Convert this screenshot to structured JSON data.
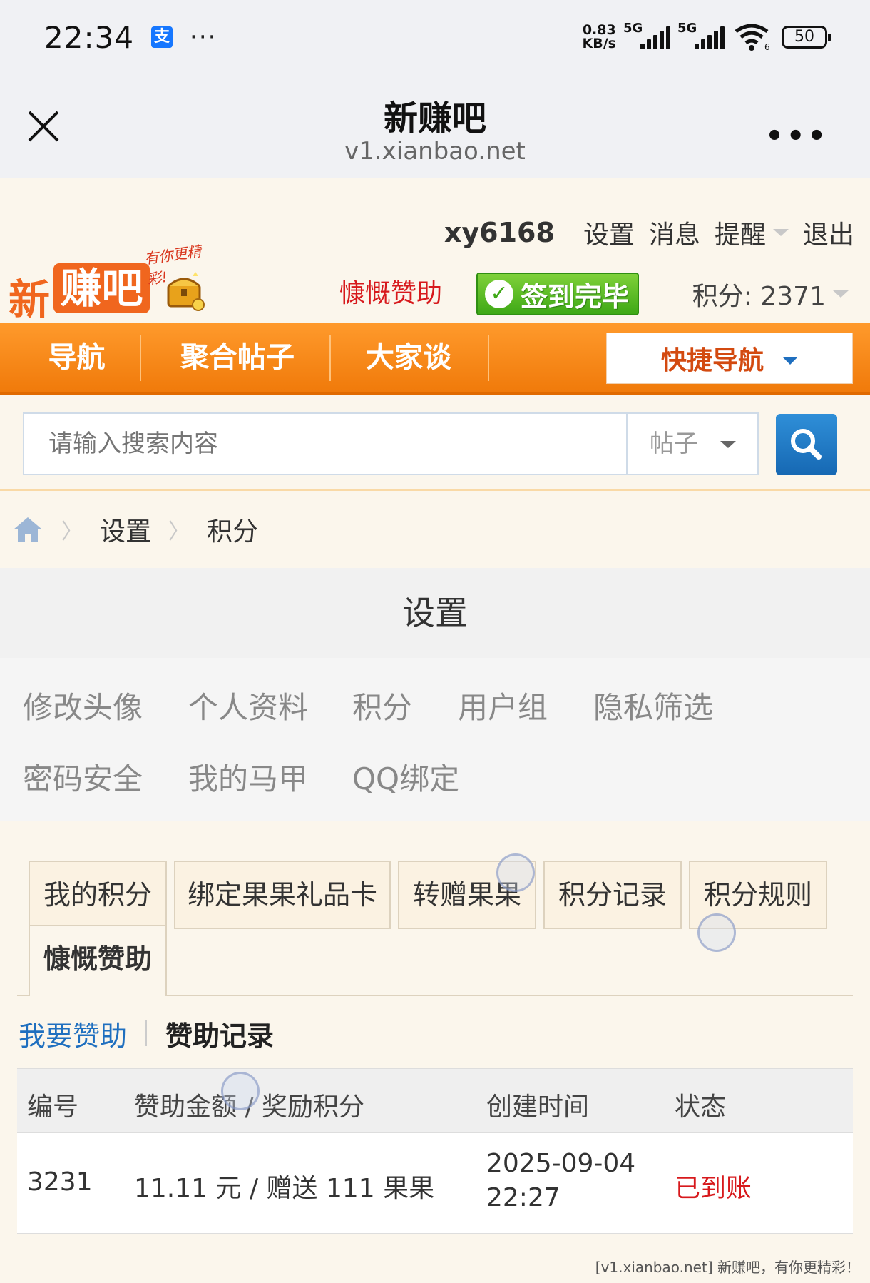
{
  "status_bar": {
    "time": "22:34",
    "pay_icon_glyph": "支",
    "overflow": "···",
    "net_speed_value": "0.83",
    "net_speed_unit": "KB/s",
    "signal1_label": "5G",
    "signal2_label": "5G",
    "wifi_badge": "6",
    "battery": "50"
  },
  "title_bar": {
    "title": "新赚吧",
    "url": "v1.xianbao.net",
    "more": "•••"
  },
  "header": {
    "logo_xin": "新",
    "logo_box": "赚吧",
    "slogan": "有你更精彩!",
    "username": "xy6168",
    "links": [
      "设置",
      "消息",
      "提醒",
      "退出"
    ],
    "donate_link": "慷慨赞助",
    "signin_label": "签到完毕",
    "points_label": "积分: 2371"
  },
  "nav": {
    "items": [
      "导航",
      "聚合帖子",
      "大家谈"
    ],
    "quick_nav": "快捷导航"
  },
  "search": {
    "placeholder": "请输入搜索内容",
    "type": "帖子"
  },
  "breadcrumb": {
    "items": [
      "设置",
      "积分"
    ]
  },
  "settings": {
    "title": "设置",
    "menu": [
      "修改头像",
      "个人资料",
      "积分",
      "用户组",
      "隐私筛选",
      "密码安全",
      "我的马甲",
      "QQ绑定"
    ]
  },
  "tabs": [
    "我的积分",
    "绑定果果礼品卡",
    "转赠果果",
    "积分记录",
    "积分规则",
    "慷慨赞助"
  ],
  "active_tab": "慷慨赞助",
  "subtabs": {
    "link": "我要赞助",
    "current": "赞助记录"
  },
  "table": {
    "headers": [
      "编号",
      "赞助金额 / 奖励积分",
      "创建时间",
      "状态"
    ],
    "rows": [
      {
        "id": "3231",
        "amount": "11.11 元 / 赠送 111 果果",
        "date": "2025-09-04",
        "time": "22:27",
        "status": "已到账"
      }
    ]
  },
  "footer_note": "[v1.xianbao.net] 新赚吧，有你更精彩！",
  "colors": {
    "accent_orange": "#f07a0a",
    "status_red": "#d7191c",
    "link_blue": "#1f6fbf",
    "signin_green": "#3ea816"
  }
}
